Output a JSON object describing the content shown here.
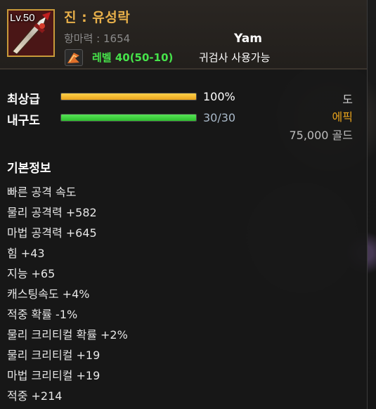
{
  "item": {
    "level_badge": "Lv.50",
    "name": "진 : 유성락",
    "magic_resist": "항마력 : 1654",
    "player_name": "Yam",
    "level_requirement": "레벨 40(50-10)",
    "class_requirement": "귀검사 사용가능"
  },
  "grade": {
    "label": "최상급",
    "percent_text": "100%",
    "fill_fraction": 1.0,
    "color": "#e8a31c"
  },
  "durability": {
    "label": "내구도",
    "value_text": "30/30",
    "fill_fraction": 1.0,
    "color": "#2fbf2f"
  },
  "right_info": {
    "type": "도",
    "rarity": "에픽",
    "price": "75,000 골드",
    "rarity_color": "#e8a31c"
  },
  "basic_info": {
    "title": "기본정보",
    "stats": [
      "빠른 공격 속도",
      "물리 공격력 +582",
      "마법 공격력 +645",
      "힘 +43",
      "지능 +65",
      "캐스팅속도 +4%",
      "적중 확률 -1%",
      "물리 크리티컬 확률 +2%",
      "물리 크리티컬 +19",
      "마법 크리티컬 +19",
      "적중 +214"
    ]
  },
  "icons": {
    "item_icon": "sword-icon",
    "class_icon": "ghost-knight-class-icon"
  }
}
